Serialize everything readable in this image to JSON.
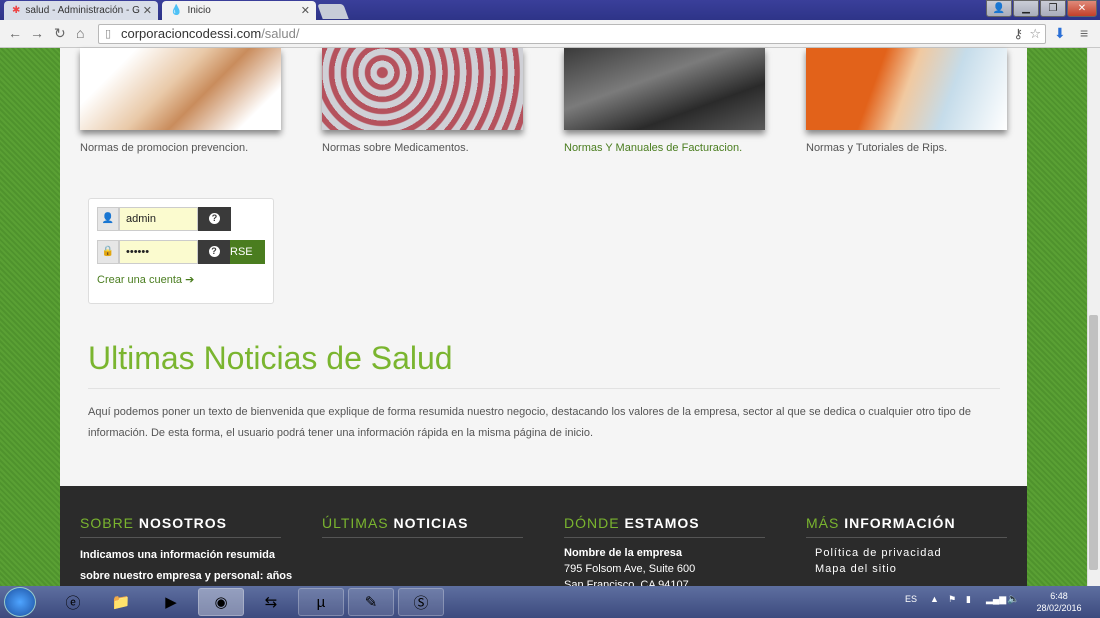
{
  "browser": {
    "tabs": [
      {
        "label": "salud - Administración - G",
        "icon": "joomla-icon"
      },
      {
        "label": "Inicio",
        "icon": "drop-icon"
      }
    ],
    "url_host": "corporacioncodessi.com",
    "url_path": "/salud/",
    "window_buttons": [
      "back",
      "min",
      "max",
      "close"
    ]
  },
  "gallery": [
    {
      "caption": "Normas de promocion prevencion."
    },
    {
      "caption": "Normas sobre Medicamentos."
    },
    {
      "caption": "Normas Y Manuales de Facturacion."
    },
    {
      "caption": "Normas y Tutoriales de Rips."
    }
  ],
  "login": {
    "username": "admin",
    "password": "••••••",
    "submit_label": "RSE",
    "help_glyph": "?",
    "create_account": "Crear una cuenta"
  },
  "news": {
    "title": "Ultimas Noticias de Salud",
    "body": "Aquí podemos poner un texto de bienvenida que explique de forma resumida nuestro negocio, destacando los valores de la empresa, sector al que se dedica o cualquier otro tipo de información. De esta forma, el usuario podrá tener una información rápida en la misma página de inicio."
  },
  "footer": {
    "col1": {
      "head_a": "SOBRE",
      "head_b": "NOSOTROS",
      "text1": "Indicamos una información resumida",
      "text2": "sobre nuestro empresa y personal: años"
    },
    "col2": {
      "head_a": "ÚLTIMAS",
      "head_b": "NOTICIAS"
    },
    "col3": {
      "head_a": "DÓNDE",
      "head_b": "ESTAMOS",
      "name": "Nombre de la empresa",
      "addr1": "795 Folsom Ave, Suite 600",
      "addr2": "San Francisco, CA 94107"
    },
    "col4": {
      "head_a": "MÁS",
      "head_b": "INFORMACIÓN",
      "link1": "Política de privacidad",
      "link2": "Mapa del sitio"
    }
  },
  "taskbar": {
    "lang": "ES",
    "time": "6:48",
    "date": "28/02/2016"
  },
  "colors": {
    "accent": "#7ab52f",
    "footer_bg": "#2b2b2b",
    "link": "#4a7d1f"
  }
}
